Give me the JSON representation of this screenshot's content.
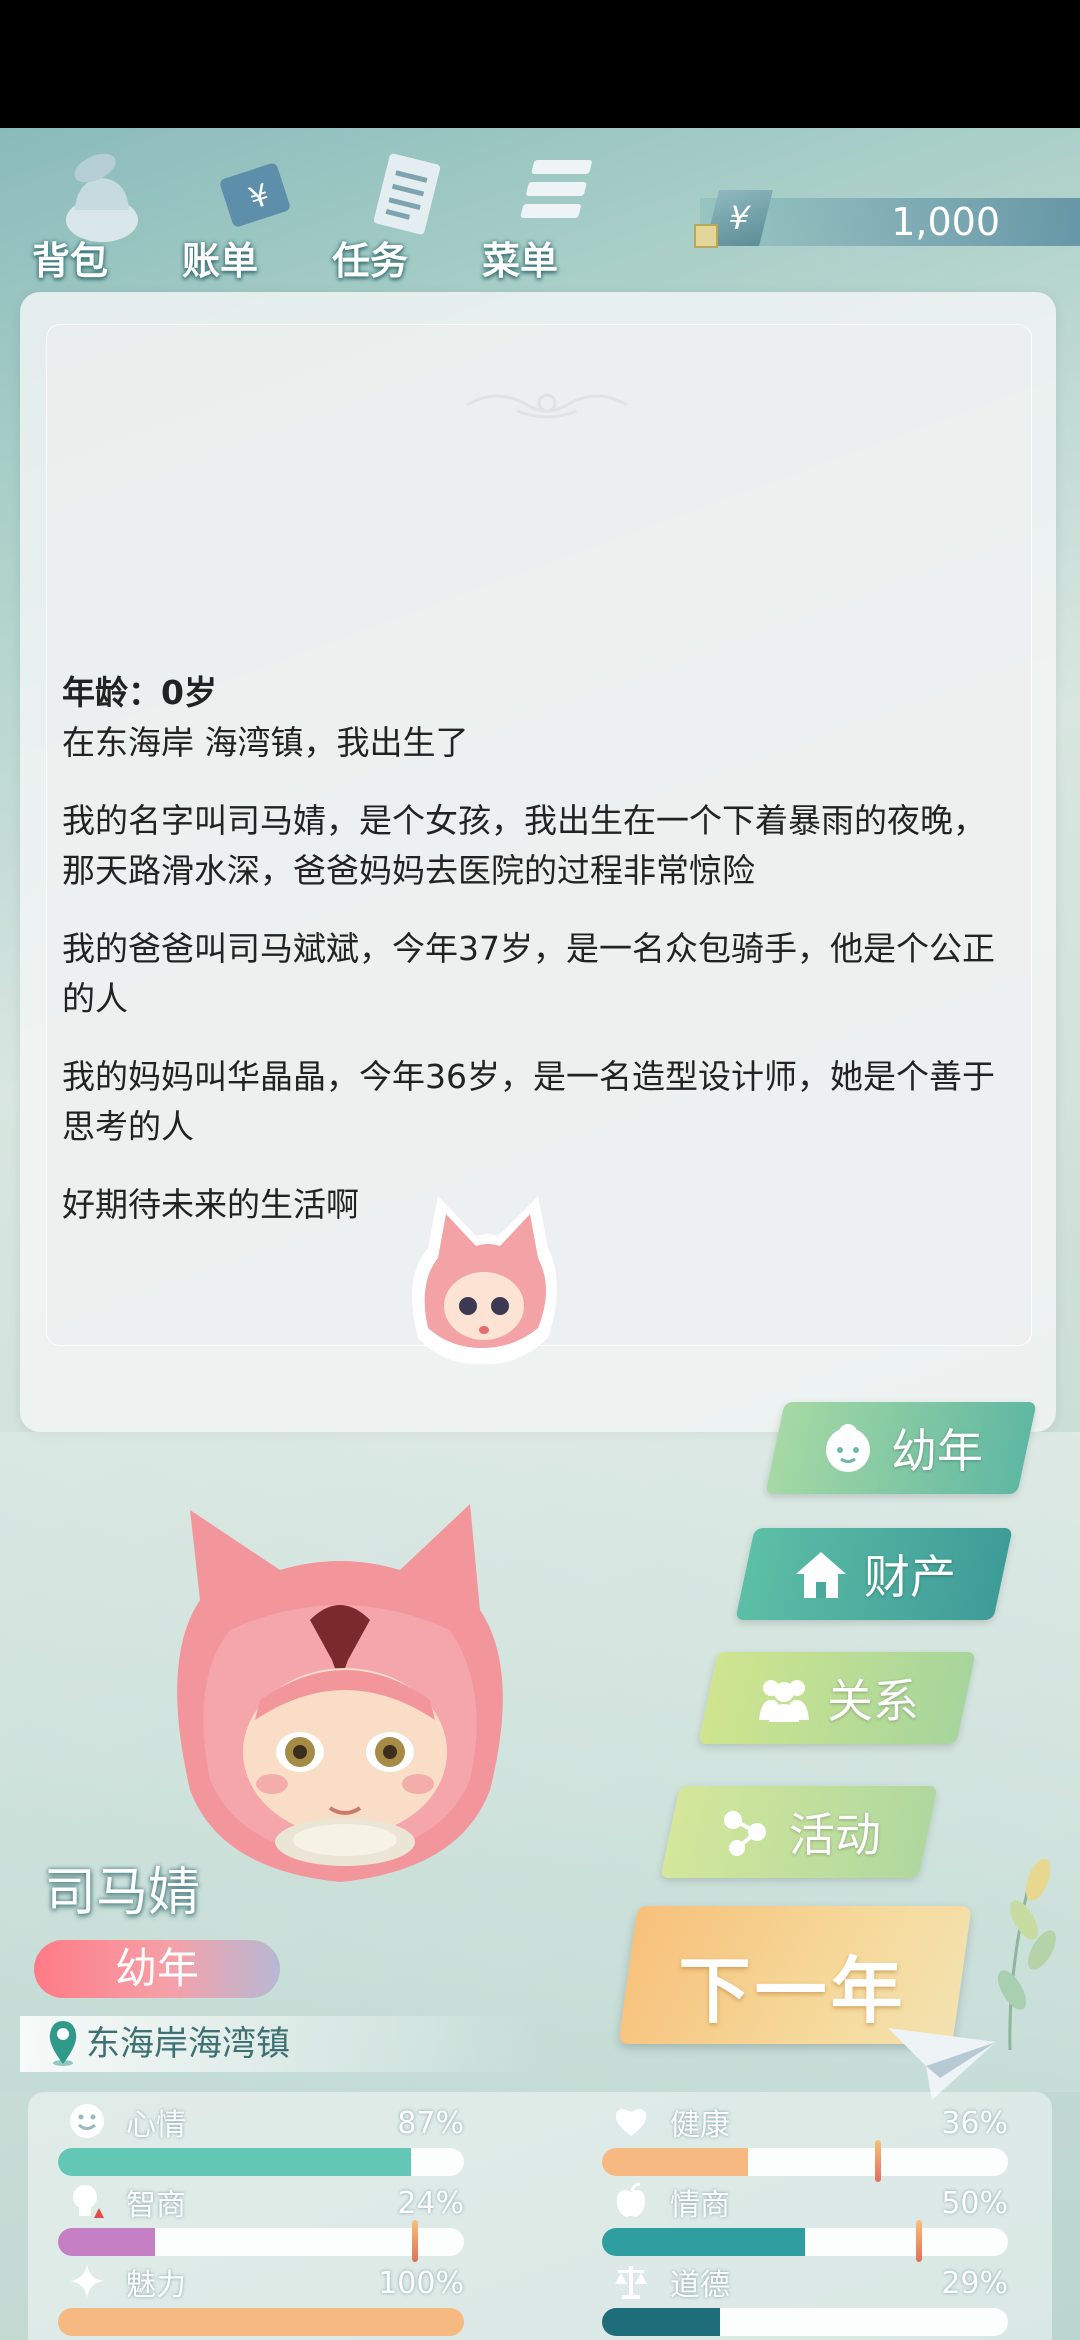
{
  "menu": {
    "bag": "背包",
    "bill": "账单",
    "tasks": "任务",
    "menu": "菜单"
  },
  "money": {
    "symbol": "¥",
    "value": "1,000"
  },
  "story": {
    "age_line": "年龄：0岁",
    "born_line": "在东海岸 海湾镇，我出生了",
    "paragraphs": [
      "我的名字叫司马婧，是个女孩，我出生在一个下着暴雨的夜晚，那天路滑水深，爸爸妈妈去医院的过程非常惊险",
      "我的爸爸叫司马斌斌，今年37岁，是一名众包骑手，他是个公正的人",
      "我的妈妈叫华晶晶，今年36岁，是一名造型设计师，她是个善于思考的人",
      "好期待未来的生活啊"
    ]
  },
  "character": {
    "name": "司马婧",
    "stage": "幼年",
    "location": "东海岸海湾镇"
  },
  "buttons": {
    "youth": "幼年",
    "assets": "财产",
    "relations": "关系",
    "activities": "活动",
    "next_year": "下一年"
  },
  "stats": {
    "mood": {
      "label": "心情",
      "value": "87%",
      "fill": 0.87,
      "color": "#63c7b5"
    },
    "health": {
      "label": "健康",
      "value": "36%",
      "fill": 0.36,
      "color": "#f7b982",
      "marker": 0.68
    },
    "iq": {
      "label": "智商",
      "value": "24%",
      "fill": 0.24,
      "color": "#c57fc4",
      "marker": 0.88
    },
    "eq": {
      "label": "情商",
      "value": "50%",
      "fill": 0.5,
      "color": "#2f9ea0",
      "marker": 0.78
    },
    "charm": {
      "label": "魅力",
      "value": "100%",
      "fill": 1.0,
      "color": "#f7b982"
    },
    "morals": {
      "label": "道德",
      "value": "29%",
      "fill": 0.29,
      "color": "#1f6d7a"
    }
  }
}
